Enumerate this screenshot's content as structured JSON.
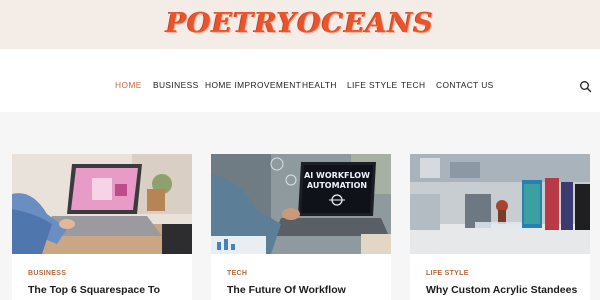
{
  "site": {
    "logo": "POETRYOCEANS"
  },
  "nav": {
    "items": [
      {
        "label": "HOME",
        "active": true
      },
      {
        "label": "BUSINESS",
        "active": false
      },
      {
        "label": "HOME IMPROVEMENT",
        "active": false
      },
      {
        "label": "HEALTH",
        "active": false
      },
      {
        "label": "LIFE STYLE",
        "active": false
      },
      {
        "label": "TECH",
        "active": false
      },
      {
        "label": "CONTACT US",
        "active": false
      }
    ],
    "search_icon": "search-icon"
  },
  "posts": [
    {
      "category": "BUSINESS",
      "title": "The Top 6 Squarespace To"
    },
    {
      "category": "TECH",
      "title": "The Future Of Workflow"
    },
    {
      "category": "LIFE STYLE",
      "title": "Why Custom Acrylic Standees"
    }
  ],
  "images": {
    "post2_screen_line1": "AI WORKFLOW",
    "post2_screen_line2": "AUTOMATION"
  },
  "colors": {
    "header_bg": "#f4ece6",
    "logo": "#e8552d",
    "accent": "#c56b3d",
    "category": "#b9673b"
  }
}
